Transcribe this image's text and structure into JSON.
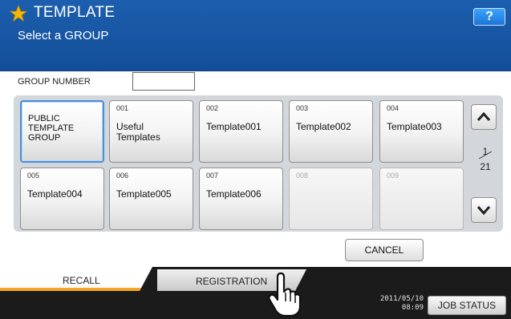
{
  "header": {
    "title": "TEMPLATE",
    "subtitle": "Select a GROUP",
    "help_label": "?"
  },
  "group_number": {
    "label": "GROUP NUMBER",
    "value": ""
  },
  "tiles": [
    {
      "number": "",
      "name": "PUBLIC TEMPLATE GROUP",
      "selected": true,
      "enabled": true
    },
    {
      "number": "001",
      "name": "Useful Templates",
      "enabled": true
    },
    {
      "number": "002",
      "name": "Template001",
      "enabled": true
    },
    {
      "number": "003",
      "name": "Template002",
      "enabled": true
    },
    {
      "number": "004",
      "name": "Template003",
      "enabled": true
    },
    {
      "number": "005",
      "name": "Template004",
      "enabled": true
    },
    {
      "number": "006",
      "name": "Template005",
      "enabled": true
    },
    {
      "number": "007",
      "name": "Template006",
      "enabled": true
    },
    {
      "number": "008",
      "name": "",
      "enabled": false
    },
    {
      "number": "009",
      "name": "",
      "enabled": false
    }
  ],
  "pagination": {
    "current": "1",
    "total": "21",
    "up_icon": "chevron-up-icon",
    "down_icon": "chevron-down-icon"
  },
  "actions": {
    "cancel_label": "CANCEL"
  },
  "tabs": {
    "recall_label": "RECALL",
    "registration_label": "REGISTRATION"
  },
  "status": {
    "date": "2011/05/10",
    "time": "08:09",
    "job_status_label": "JOB STATUS"
  },
  "colors": {
    "header": "#1c5fae",
    "accent_tab": "#f5a623",
    "selected_border": "#4a8fd8"
  }
}
